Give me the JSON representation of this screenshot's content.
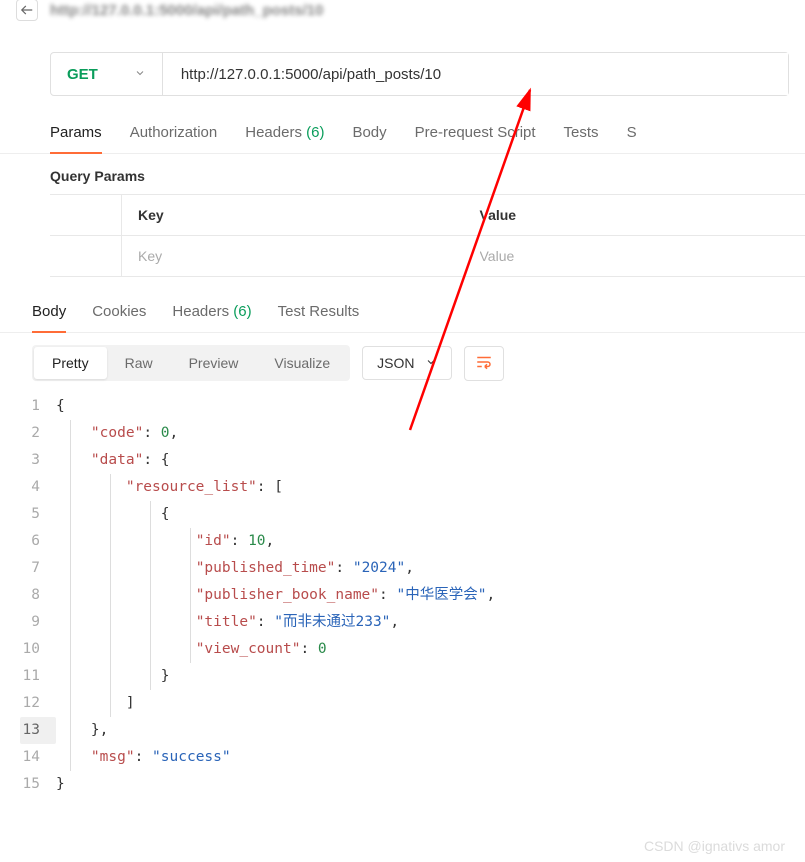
{
  "top": {
    "blurred_url": "http://127.0.0.1:5000/api/path_posts/10"
  },
  "request": {
    "method": "GET",
    "url": "http://127.0.0.1:5000/api/path_posts/10"
  },
  "request_tabs": [
    {
      "label": "Params",
      "active": true
    },
    {
      "label": "Authorization"
    },
    {
      "label": "Headers",
      "count": "(6)"
    },
    {
      "label": "Body"
    },
    {
      "label": "Pre-request Script"
    },
    {
      "label": "Tests"
    },
    {
      "label": "S"
    }
  ],
  "query_params": {
    "title": "Query Params",
    "headers": {
      "key": "Key",
      "value": "Value"
    },
    "placeholders": {
      "key": "Key",
      "value": "Value"
    }
  },
  "response_tabs": [
    {
      "label": "Body",
      "active": true
    },
    {
      "label": "Cookies"
    },
    {
      "label": "Headers",
      "count": "(6)"
    },
    {
      "label": "Test Results"
    }
  ],
  "format": {
    "modes": [
      {
        "label": "Pretty",
        "active": true
      },
      {
        "label": "Raw"
      },
      {
        "label": "Preview"
      },
      {
        "label": "Visualize"
      }
    ],
    "lang": "JSON"
  },
  "response_body": {
    "code": 0,
    "data": {
      "resource_list": [
        {
          "id": 10,
          "published_time": "2024",
          "publisher_book_name": "中华医学会",
          "title": "而非未通过233",
          "view_count": 0
        }
      ]
    },
    "msg": "success"
  },
  "code_lines": [
    {
      "n": 1,
      "indent": 0,
      "tokens": [
        [
          "punct",
          "{"
        ]
      ]
    },
    {
      "n": 2,
      "indent": 1,
      "tokens": [
        [
          "key",
          "\"code\""
        ],
        [
          "punct",
          ": "
        ],
        [
          "num",
          "0"
        ],
        [
          "punct",
          ","
        ]
      ]
    },
    {
      "n": 3,
      "indent": 1,
      "tokens": [
        [
          "key",
          "\"data\""
        ],
        [
          "punct",
          ": {"
        ]
      ]
    },
    {
      "n": 4,
      "indent": 2,
      "tokens": [
        [
          "key",
          "\"resource_list\""
        ],
        [
          "punct",
          ": ["
        ]
      ]
    },
    {
      "n": 5,
      "indent": 3,
      "tokens": [
        [
          "punct",
          "{"
        ]
      ]
    },
    {
      "n": 6,
      "indent": 4,
      "tokens": [
        [
          "key",
          "\"id\""
        ],
        [
          "punct",
          ": "
        ],
        [
          "num",
          "10"
        ],
        [
          "punct",
          ","
        ]
      ]
    },
    {
      "n": 7,
      "indent": 4,
      "tokens": [
        [
          "key",
          "\"published_time\""
        ],
        [
          "punct",
          ": "
        ],
        [
          "str",
          "\"2024\""
        ],
        [
          "punct",
          ","
        ]
      ]
    },
    {
      "n": 8,
      "indent": 4,
      "tokens": [
        [
          "key",
          "\"publisher_book_name\""
        ],
        [
          "punct",
          ": "
        ],
        [
          "str",
          "\"中华医学会\""
        ],
        [
          "punct",
          ","
        ]
      ]
    },
    {
      "n": 9,
      "indent": 4,
      "tokens": [
        [
          "key",
          "\"title\""
        ],
        [
          "punct",
          ": "
        ],
        [
          "str",
          "\"而非未通过233\""
        ],
        [
          "punct",
          ","
        ]
      ]
    },
    {
      "n": 10,
      "indent": 4,
      "tokens": [
        [
          "key",
          "\"view_count\""
        ],
        [
          "punct",
          ": "
        ],
        [
          "num",
          "0"
        ]
      ]
    },
    {
      "n": 11,
      "indent": 3,
      "tokens": [
        [
          "punct",
          "}"
        ]
      ]
    },
    {
      "n": 12,
      "indent": 2,
      "tokens": [
        [
          "punct",
          "]"
        ]
      ]
    },
    {
      "n": 13,
      "indent": 1,
      "current": true,
      "tokens": [
        [
          "punct",
          "},"
        ]
      ]
    },
    {
      "n": 14,
      "indent": 1,
      "tokens": [
        [
          "key",
          "\"msg\""
        ],
        [
          "punct",
          ": "
        ],
        [
          "str",
          "\"success\""
        ]
      ]
    },
    {
      "n": 15,
      "indent": 0,
      "tokens": [
        [
          "punct",
          "}"
        ]
      ]
    }
  ],
  "watermark": "CSDN @ignativs  amor"
}
